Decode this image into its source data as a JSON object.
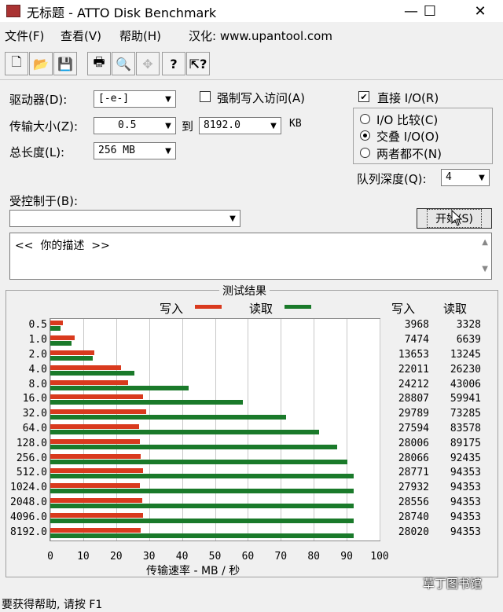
{
  "window": {
    "title": "无标题 - ATTO Disk Benchmark"
  },
  "menu": [
    "文件(F)",
    "查看(V)",
    "帮助(H)",
    "汉化: www.upantool.com"
  ],
  "toolbar": [
    {
      "icon": "new-document-icon",
      "glyph": "🗋"
    },
    {
      "icon": "open-folder-icon",
      "glyph": "📂"
    },
    {
      "icon": "save-icon",
      "glyph": "💾"
    },
    {
      "icon": "print-icon",
      "glyph": "🖶"
    },
    {
      "icon": "print-preview-icon",
      "glyph": "🔍"
    },
    {
      "icon": "move-icon",
      "glyph": "✥"
    },
    {
      "icon": "help-icon",
      "glyph": "?"
    },
    {
      "icon": "context-help-icon",
      "glyph": "?"
    }
  ],
  "form": {
    "drive_label": "驱动器(D):",
    "drive_value": "[-e-]",
    "transfer_label": "传输大小(Z):",
    "transfer_from": "0.5",
    "to_label": "到",
    "transfer_to": "8192.0",
    "unit": "KB",
    "total_label": "总长度(L):",
    "total_value": "256 MB",
    "force_write_label": "强制写入访问(A)",
    "direct_io_label": "直接 I/O(R)",
    "io_compare": "I/O 比较(C)",
    "overlapped_io": "交叠 I/O(O)",
    "neither": "两者都不(N)",
    "queue_label": "队列深度(Q):",
    "queue_value": "4",
    "controlled_label": "受控制于(B):",
    "controlled_value": "",
    "start_button": "开始(S)",
    "description": "<<  你的描述  >>"
  },
  "results": {
    "title": "测试结果",
    "legend_write": "写入",
    "legend_read": "读取",
    "col_write": "写入",
    "col_read": "读取",
    "xlabel": "传输速率 - MB / 秒",
    "colors": {
      "write": "#d93a1e",
      "read": "#1a7a2a"
    }
  },
  "chart_data": {
    "type": "bar",
    "categories": [
      "0.5",
      "1.0",
      "2.0",
      "4.0",
      "8.0",
      "16.0",
      "32.0",
      "64.0",
      "128.0",
      "256.0",
      "512.0",
      "1024.0",
      "2048.0",
      "4096.0",
      "8192.0"
    ],
    "series": [
      {
        "name": "写入",
        "values": [
          3.9,
          7.3,
          13.3,
          21.5,
          23.6,
          28.1,
          29.1,
          26.9,
          27.3,
          27.4,
          28.1,
          27.3,
          27.9,
          28.1,
          27.4
        ]
      },
      {
        "name": "读取",
        "values": [
          3.2,
          6.5,
          12.9,
          25.6,
          42.0,
          58.5,
          71.6,
          81.6,
          87.1,
          90.3,
          92.1,
          92.1,
          92.1,
          92.1,
          92.1
        ]
      }
    ],
    "write_values": [
      "3968",
      "7474",
      "13653",
      "22011",
      "24212",
      "28807",
      "29789",
      "27594",
      "28006",
      "28066",
      "28771",
      "27932",
      "28556",
      "28740",
      "28020"
    ],
    "read_values": [
      "3328",
      "6639",
      "13245",
      "26230",
      "43006",
      "59941",
      "73285",
      "83578",
      "89175",
      "92435",
      "94353",
      "94353",
      "94353",
      "94353",
      "94353"
    ],
    "xticks": [
      "0",
      "10",
      "20",
      "30",
      "40",
      "50",
      "60",
      "70",
      "80",
      "90",
      "100"
    ],
    "xlim": [
      0,
      100
    ]
  },
  "status": "要获得帮助, 请按 F1",
  "watermark": "草丁图书馆"
}
